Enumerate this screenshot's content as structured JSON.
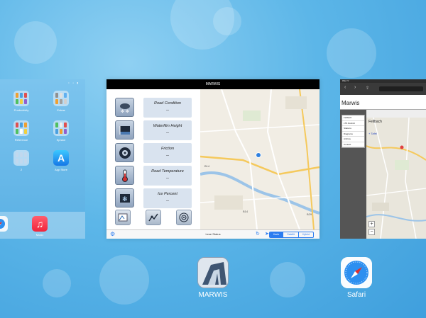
{
  "home_card": {
    "status_right": "≈ ▪ ▮",
    "icons": [
      {
        "label": "Productivity",
        "kind": "folder"
      },
      {
        "label": "Extras",
        "kind": "folder"
      },
      {
        "label": "Reference",
        "kind": "folder"
      },
      {
        "label": "Sprave",
        "kind": "folder"
      },
      {
        "label": "2",
        "kind": "folder"
      },
      {
        "label": "App Store",
        "kind": "appstore"
      }
    ],
    "dock": [
      {
        "label": "",
        "kind": "safari"
      },
      {
        "label": "Music",
        "kind": "music"
      }
    ]
  },
  "marwis_card": {
    "status_title": "MARWIS",
    "fields": [
      {
        "title": "Road Condition",
        "value": "--",
        "icon": "snow-cloud-icon"
      },
      {
        "title": "Waterfilm Height",
        "value": "--",
        "icon": "waterfilm-icon"
      },
      {
        "title": "Friction",
        "value": "--",
        "icon": "tire-icon"
      },
      {
        "title": "Road Temperature",
        "value": "--",
        "icon": "thermometer-icon"
      },
      {
        "title": "Ice Percent",
        "value": "--",
        "icon": "ice-icon"
      }
    ],
    "toolbar": {
      "status_text": "Lese Status",
      "segments": [
        "Karte",
        "Satellit",
        "Hybrid"
      ]
    },
    "map_labels": {
      "road_a": "B14",
      "road_b": "B14",
      "road_c": "B29"
    }
  },
  "safari_card": {
    "status": "iPad ᯤ",
    "page_title": "Marwis",
    "menu_items": [
      "Fellbach",
      "LTS Dubrolt",
      "Stations",
      "Diagrams",
      "Archive",
      "Contact"
    ],
    "place_label": "Fellbach",
    "map_link": "+ Tafel",
    "zoom_in": "+",
    "zoom_out": "−"
  },
  "apps": {
    "marwis": {
      "label": "MARWIS"
    },
    "safari": {
      "label": "Safari"
    }
  },
  "colors": {
    "wallpaper": "#5cb6e8",
    "segment_accent": "#2b7cf0",
    "field_box": "#d9e3ef",
    "map_pin": "#2f80e0"
  }
}
